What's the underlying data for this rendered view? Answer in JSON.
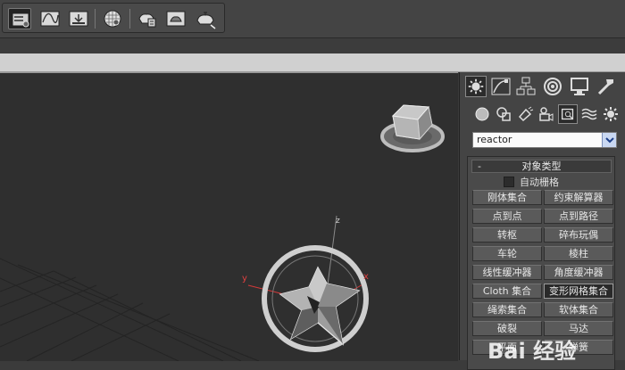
{
  "toolbar": {
    "buttons": [
      {
        "icon": "scene-explorer-icon",
        "active": true
      },
      {
        "icon": "curve-editor-icon",
        "active": false
      },
      {
        "icon": "schematic-view-icon",
        "active": false
      },
      {
        "icon": "material-editor-icon",
        "active": false
      },
      {
        "icon": "render-setup-icon",
        "active": false
      },
      {
        "icon": "rendered-frame-window-icon",
        "active": false
      },
      {
        "icon": "render-production-icon",
        "active": false
      }
    ]
  },
  "command_panel": {
    "tabs": [
      "create-tab-icon",
      "modify-tab-icon",
      "hierarchy-tab-icon",
      "motion-tab-icon",
      "display-tab-icon",
      "utilities-tab-icon"
    ],
    "subcategories": [
      "geometry-icon",
      "shapes-icon",
      "lights-icon",
      "cameras-icon",
      "helpers-icon",
      "space-warps-icon",
      "systems-icon"
    ],
    "category_value": "reactor",
    "rollout": {
      "minus": "-",
      "title": "对象类型",
      "autogrid_label": "自动栅格",
      "buttons": [
        "刚体集合",
        "约束解算器",
        "点到点",
        "点到路径",
        "转枢",
        "碎布玩偶",
        "车轮",
        "棱柱",
        "线性缓冲器",
        "角度缓冲器",
        "Cloth 集合",
        "变形网格集合",
        "绳索集合",
        "软体集合",
        "破裂",
        "马达",
        "平面",
        "弹簧"
      ],
      "selected_button": "变形网格集合"
    }
  },
  "viewport": {
    "axis_labels": {
      "x": "x",
      "y": "y",
      "z": "z"
    }
  },
  "watermark": {
    "text": "Bai 经验"
  },
  "colors": {
    "panel": "#444444",
    "viewport": "#2f2f2f",
    "axis_x": "#d23a3a",
    "selection_highlight": "#2a2a2a"
  }
}
